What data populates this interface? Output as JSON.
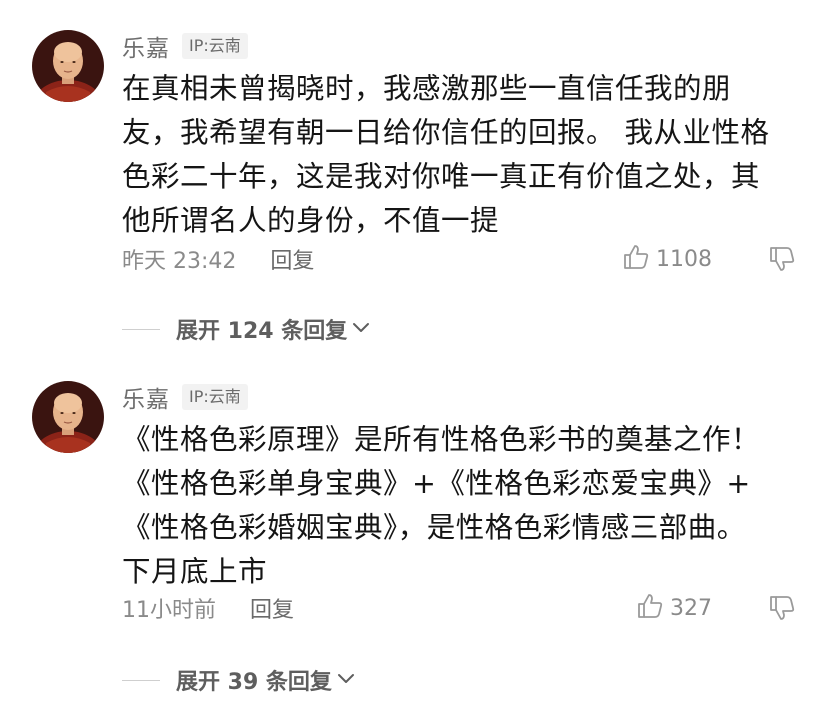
{
  "comments": [
    {
      "author": "乐嘉",
      "ip": "IP:云南",
      "lines": [
        "在真相未曾揭晓时，我感激那些一直信任我的朋",
        "友，我希望有朝一日给你信任的回报。 我从业性格",
        "色彩二十年，这是我对你唯一真正有价值之处，其",
        "他所谓名人的身份，不值一提"
      ],
      "time": "昨天 23:42",
      "reply_label": "回复",
      "like_count": "1108",
      "expand_label": "展开 124 条回复"
    },
    {
      "author": "乐嘉",
      "ip": "IP:云南",
      "lines": [
        "《性格色彩原理》是所有性格色彩书的奠基之作！",
        "《性格色彩单身宝典》+《性格色彩恋爱宝典》+",
        "《性格色彩婚姻宝典》，是性格色彩情感三部曲。",
        "下月底上市"
      ],
      "time": "11小时前",
      "reply_label": "回复",
      "like_count": "327",
      "expand_label": "展开 39 条回复"
    }
  ],
  "icons": {
    "like": "thumbs-up-icon",
    "dislike": "thumbs-down-icon",
    "chevron": "chevron-down-icon"
  },
  "colors": {
    "text": "#151515",
    "meta": "#8a8a8a",
    "badge_bg": "#f2f2f2",
    "robe": "#8b2318"
  }
}
